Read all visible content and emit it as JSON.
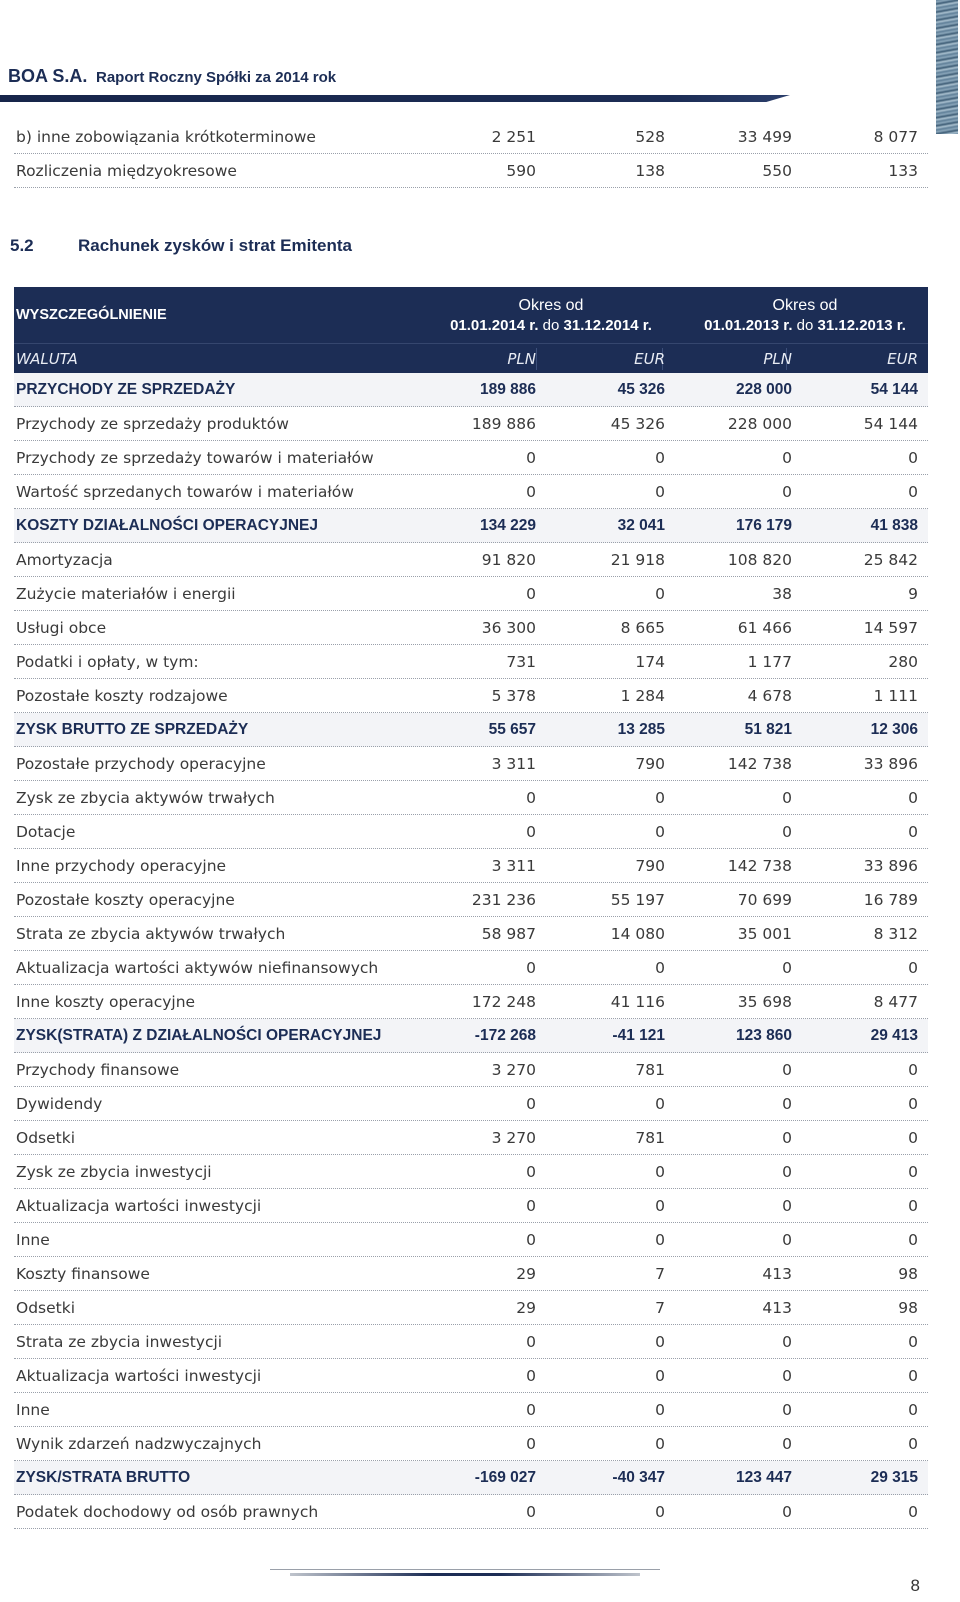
{
  "header": {
    "company": "BOA S.A.",
    "title": "Raport Roczny Spółki za 2014 rok"
  },
  "top_rows": [
    {
      "label": "b) inne zobowiązania krótkoterminowe",
      "v": [
        "2 251",
        "528",
        "33 499",
        "8 077"
      ]
    },
    {
      "label": "Rozliczenia międzyokresowe",
      "v": [
        "590",
        "138",
        "550",
        "133"
      ]
    }
  ],
  "section": {
    "number": "5.2",
    "title": "Rachunek zysków i strat Emitenta"
  },
  "table": {
    "head_label": "WYSZCZEGÓLNIENIE",
    "period1": {
      "line1": "Okres od",
      "from": "01.01.2014 r.",
      "do": "do",
      "to": "31.12.2014 r."
    },
    "period2": {
      "line1": "Okres od",
      "from": "01.01.2013 r.",
      "do": "do",
      "to": "31.12.2013 r."
    },
    "currency_row": {
      "label": "WALUTA",
      "v": [
        "PLN",
        "EUR",
        "PLN",
        "EUR"
      ]
    },
    "rows": [
      {
        "label": "PRZYCHODY ZE SPRZEDAŻY",
        "v": [
          "189 886",
          "45 326",
          "228 000",
          "54 144"
        ]
      },
      {
        "label": "Przychody ze sprzedaży produktów",
        "v": [
          "189 886",
          "45 326",
          "228 000",
          "54 144"
        ]
      },
      {
        "label": "Przychody ze sprzedaży towarów i materiałów",
        "v": [
          "0",
          "0",
          "0",
          "0"
        ]
      },
      {
        "label": "Wartość sprzedanych towarów i materiałów",
        "v": [
          "0",
          "0",
          "0",
          "0"
        ]
      },
      {
        "label": "KOSZTY DZIAŁALNOŚCI OPERACYJNEJ",
        "v": [
          "134 229",
          "32 041",
          "176 179",
          "41 838"
        ]
      },
      {
        "label": "Amortyzacja",
        "v": [
          "91 820",
          "21 918",
          "108 820",
          "25 842"
        ]
      },
      {
        "label": "Zużycie materiałów i energii",
        "v": [
          "0",
          "0",
          "38",
          "9"
        ]
      },
      {
        "label": "Usługi obce",
        "v": [
          "36 300",
          "8 665",
          "61 466",
          "14 597"
        ]
      },
      {
        "label": "Podatki i opłaty, w tym:",
        "v": [
          "731",
          "174",
          "1 177",
          "280"
        ]
      },
      {
        "label": "Pozostałe koszty rodzajowe",
        "v": [
          "5 378",
          "1 284",
          "4 678",
          "1 111"
        ]
      },
      {
        "label": "ZYSK BRUTTO ZE SPRZEDAŻY",
        "v": [
          "55 657",
          "13 285",
          "51 821",
          "12 306"
        ]
      },
      {
        "label": "Pozostałe przychody operacyjne",
        "v": [
          "3 311",
          "790",
          "142 738",
          "33 896"
        ]
      },
      {
        "label": "Zysk ze zbycia aktywów trwałych",
        "v": [
          "0",
          "0",
          "0",
          "0"
        ]
      },
      {
        "label": "Dotacje",
        "v": [
          "0",
          "0",
          "0",
          "0"
        ]
      },
      {
        "label": "Inne przychody operacyjne",
        "v": [
          "3 311",
          "790",
          "142 738",
          "33 896"
        ]
      },
      {
        "label": "Pozostałe koszty operacyjne",
        "v": [
          "231 236",
          "55 197",
          "70 699",
          "16 789"
        ]
      },
      {
        "label": "Strata ze zbycia aktywów trwałych",
        "v": [
          "58 987",
          "14 080",
          "35 001",
          "8 312"
        ]
      },
      {
        "label": "Aktualizacja wartości aktywów niefinansowych",
        "v": [
          "0",
          "0",
          "0",
          "0"
        ]
      },
      {
        "label": "Inne koszty operacyjne",
        "v": [
          "172 248",
          "41 116",
          "35 698",
          "8 477"
        ]
      },
      {
        "label": "ZYSK(STRATA) Z DZIAŁALNOŚCI OPERACYJNEJ",
        "v": [
          "-172 268",
          "-41 121",
          "123 860",
          "29 413"
        ]
      },
      {
        "label": "Przychody finansowe",
        "v": [
          "3 270",
          "781",
          "0",
          "0"
        ]
      },
      {
        "label": "Dywidendy",
        "v": [
          "0",
          "0",
          "0",
          "0"
        ]
      },
      {
        "label": "Odsetki",
        "v": [
          "3 270",
          "781",
          "0",
          "0"
        ]
      },
      {
        "label": "Zysk ze zbycia inwestycji",
        "v": [
          "0",
          "0",
          "0",
          "0"
        ]
      },
      {
        "label": "Aktualizacja wartości inwestycji",
        "v": [
          "0",
          "0",
          "0",
          "0"
        ]
      },
      {
        "label": "Inne",
        "v": [
          "0",
          "0",
          "0",
          "0"
        ]
      },
      {
        "label": "Koszty finansowe",
        "v": [
          "29",
          "7",
          "413",
          "98"
        ]
      },
      {
        "label": "Odsetki",
        "v": [
          "29",
          "7",
          "413",
          "98"
        ]
      },
      {
        "label": "Strata ze zbycia inwestycji",
        "v": [
          "0",
          "0",
          "0",
          "0"
        ]
      },
      {
        "label": "Aktualizacja wartości inwestycji",
        "v": [
          "0",
          "0",
          "0",
          "0"
        ]
      },
      {
        "label": "Inne",
        "v": [
          "0",
          "0",
          "0",
          "0"
        ]
      },
      {
        "label": "Wynik zdarzeń nadzwyczajnych",
        "v": [
          "0",
          "0",
          "0",
          "0"
        ]
      },
      {
        "label": "ZYSK/STRATA BRUTTO",
        "v": [
          "-169 027",
          "-40 347",
          "123 447",
          "29 315"
        ]
      },
      {
        "label": "Podatek dochodowy od osób prawnych",
        "v": [
          "0",
          "0",
          "0",
          "0"
        ]
      }
    ]
  },
  "footer": {
    "page_number": "8"
  }
}
